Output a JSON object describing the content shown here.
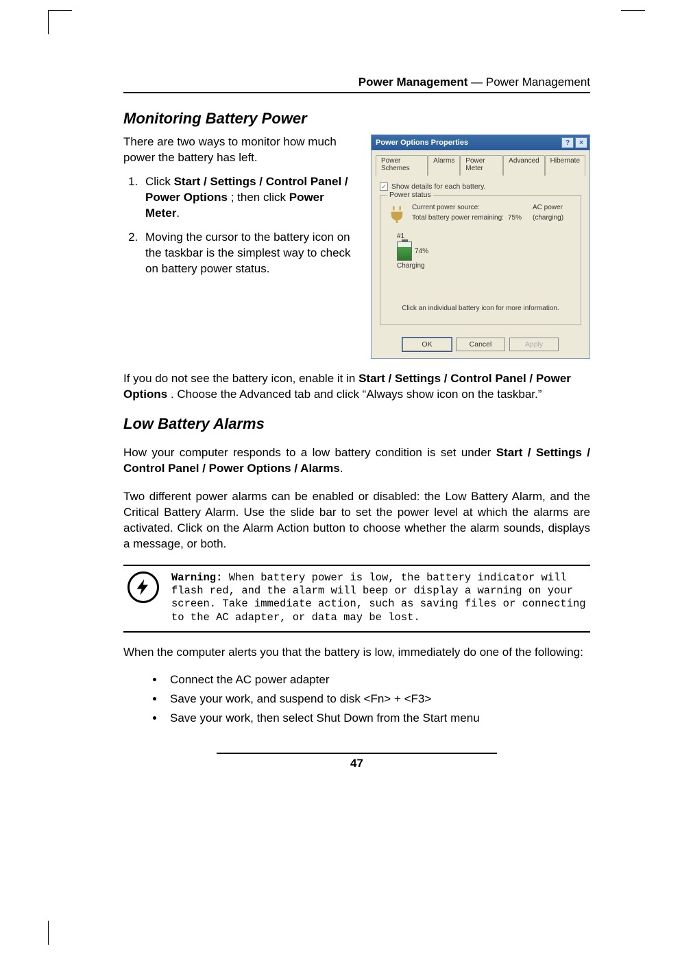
{
  "header": {
    "bold": "Power Management",
    "sep": " — ",
    "rest": "Power Management"
  },
  "section1": {
    "title": "Monitoring Battery Power",
    "intro": "There are two ways to monitor how much power the battery has left.",
    "item1_pre": "Click ",
    "item1_bold": "Start / Settings / Control Panel / Power Options",
    "item1_mid": " ; then click ",
    "item1_bold2": "Power Meter",
    "item1_after": ".",
    "item2": "Moving the cursor to the battery icon on the taskbar is the simplest way to check on battery power status."
  },
  "dialog": {
    "title": "Power Options Properties",
    "help_btn": "?",
    "close_btn": "×",
    "tabs": [
      "Power Schemes",
      "Alarms",
      "Power Meter",
      "Advanced",
      "Hibernate"
    ],
    "active_tab": 2,
    "checkbox_label": "Show details for each battery.",
    "fieldset_legend": "Power status",
    "row1_label": "Current power source:",
    "row1_value": "AC power",
    "row2_label": "Total battery power remaining:",
    "row2_value": "75%",
    "row2_status": "(charging)",
    "batt_num": "#1",
    "batt_pct": "74%",
    "batt_state": "Charging",
    "hint": "Click an individual battery icon for more information.",
    "ok": "OK",
    "cancel": "Cancel",
    "apply": "Apply"
  },
  "para_enable_pre": "If you do not see the battery icon, enable it in ",
  "para_enable_bold": "Start / Settings / Control Panel / Power Options",
  "para_enable_post": " . Choose the Advanced tab and click “Always show icon on the taskbar.”",
  "section2": {
    "title": "Low Battery Alarms",
    "p1_pre": "How your computer responds to a low battery condition is set under ",
    "p1_bold": "Start / Settings / Control Panel / Power Options / Alarms",
    "p1_post": ".",
    "p2": "Two different power alarms can be enabled or disabled: the Low Battery Alarm, and the Critical Battery Alarm. Use the slide bar to set the power level at which the alarms are activated. Click on the Alarm Action button to choose whether the alarm sounds, displays a message, or both."
  },
  "warning": {
    "label": "Warning:",
    "text": " When battery power is low, the battery indicator will flash red, and the alarm will beep or display a warning on your screen. Take immediate action, such as saving files or connecting to the AC adapter, or data may be lost."
  },
  "after_warn": "When the computer alerts you that the battery is low, immediately do one of the following:",
  "bullets": {
    "b1": "Connect the AC power adapter",
    "b2": "Save your work, and suspend to disk <Fn> + <F3>",
    "b3": "Save your work, then select Shut Down from the Start menu"
  },
  "page_number": "47"
}
